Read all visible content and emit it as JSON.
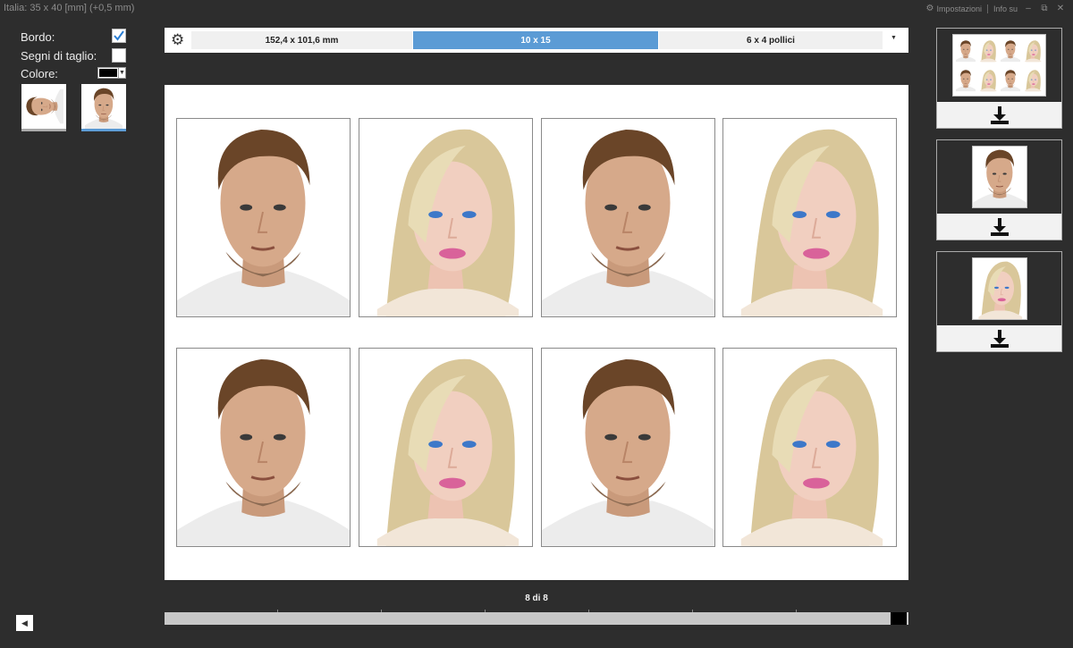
{
  "window": {
    "title": "Italia: 35 x 40 [mm] (+0,5 mm)",
    "settings_label": "Impostazioni",
    "info_label": "Info su",
    "minimize_glyph": "–",
    "restore_glyph": "⧉",
    "close_glyph": "✕"
  },
  "options": {
    "border_label": "Bordo:",
    "border_checked": true,
    "cut_marks_label": "Segni di taglio:",
    "cut_marks_checked": false,
    "color_label": "Colore:",
    "color_value": "#000000"
  },
  "size_bar": {
    "options": [
      {
        "label": "152,4 x 101,6 mm",
        "active": false
      },
      {
        "label": "10 x 15",
        "active": true
      },
      {
        "label": "6 x 4 pollici",
        "active": false
      }
    ],
    "accent_color": "#5b9bd5"
  },
  "sheet": {
    "rows": [
      [
        "man",
        "woman",
        "man",
        "woman"
      ],
      [
        "man",
        "woman",
        "man",
        "woman"
      ]
    ]
  },
  "pager": {
    "text": "8 di 8",
    "progress": 0.98
  },
  "export_panels": [
    {
      "preview": "sheet",
      "icon": "download-icon"
    },
    {
      "preview": "man",
      "icon": "download-icon"
    },
    {
      "preview": "woman",
      "icon": "download-icon"
    }
  ]
}
